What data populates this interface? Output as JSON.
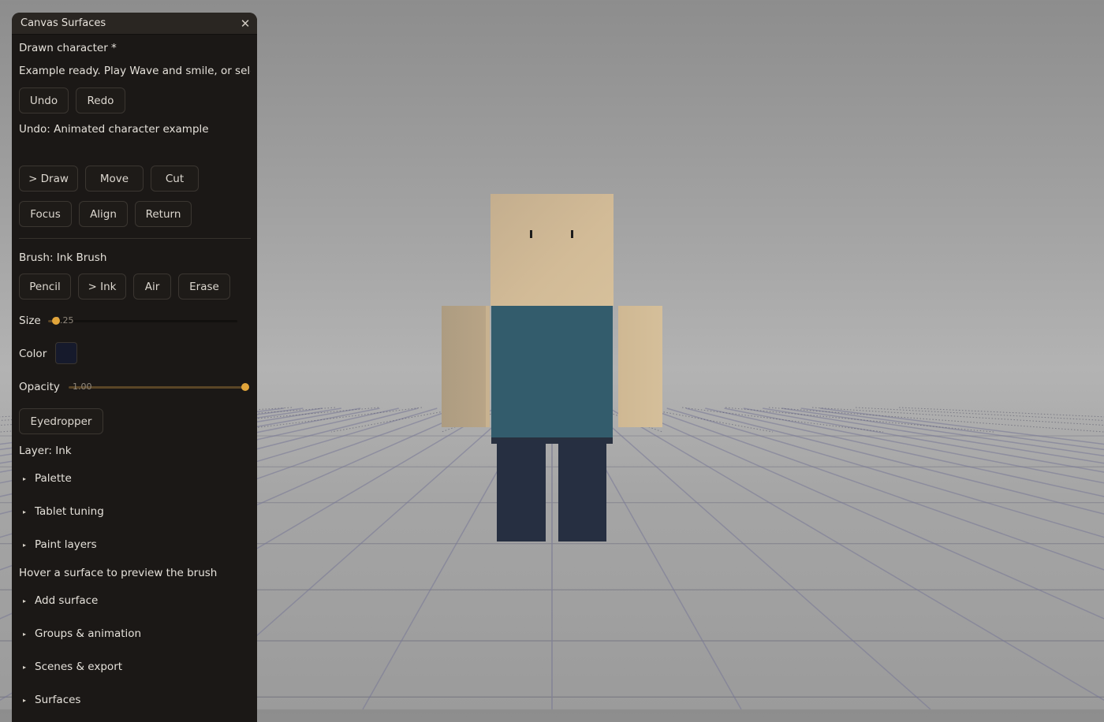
{
  "panel": {
    "title": "Canvas Surfaces",
    "close_glyph": "✕",
    "document_name": "Drawn character *",
    "status": "Example ready. Play Wave and smile, or sele",
    "undo_label": "Undo",
    "redo_label": "Redo",
    "undo_info": "Undo: Animated character example",
    "tools": {
      "draw": "> Draw",
      "move": "Move",
      "cut": "Cut",
      "focus": "Focus",
      "align": "Align",
      "return": "Return"
    },
    "brush": {
      "heading": "Brush: Ink Brush",
      "pencil": "Pencil",
      "ink": "> Ink",
      "air": "Air",
      "erase": "Erase"
    },
    "size": {
      "label": "Size",
      "value_text": "0.25",
      "fraction": 0.04
    },
    "color": {
      "label": "Color",
      "value": "#161a2c"
    },
    "opacity": {
      "label": "Opacity",
      "value_text": "1.00",
      "fraction": 1.0
    },
    "eyedropper_label": "Eyedropper",
    "layer": "Layer: Ink",
    "sections": {
      "palette": "Palette",
      "tablet_tuning": "Tablet tuning",
      "paint_layers": "Paint layers",
      "add_surface": "Add surface",
      "groups_animation": "Groups & animation",
      "scenes_export": "Scenes & export",
      "surfaces": "Surfaces"
    },
    "hover_hint": "Hover a surface to preview the brush"
  },
  "colors": {
    "accent": "#e2a53a",
    "panel_bg": "#1b1816",
    "torso": "#335c6c",
    "skin": "#d2bb97",
    "legs": "#262f41"
  },
  "icons": {
    "close": "close-icon",
    "section_caret": "caret-right-icon"
  }
}
